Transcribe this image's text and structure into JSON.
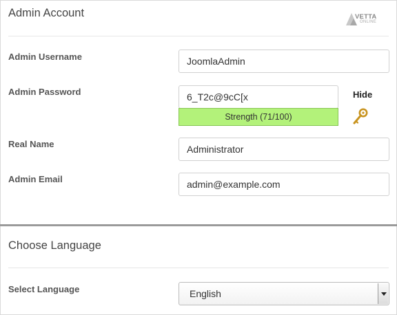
{
  "admin_account": {
    "title": "Admin Account",
    "logo": {
      "brand": "VETTA",
      "sub": "ONLINE"
    },
    "username": {
      "label": "Admin Username",
      "value": "JoomlaAdmin"
    },
    "password": {
      "label": "Admin Password",
      "value": "6_T2c@9cC[x",
      "strength_text": "Strength (71/100)",
      "strength_score": 71,
      "toggle_label": "Hide",
      "icon": "key-icon"
    },
    "real_name": {
      "label": "Real Name",
      "value": "Administrator"
    },
    "email": {
      "label": "Admin Email",
      "value": "admin@example.com"
    }
  },
  "language": {
    "title": "Choose Language",
    "select_label": "Select Language",
    "selected": "English"
  },
  "colors": {
    "strength_fill": "#b3f27a",
    "separator": "#9a9a9a"
  }
}
